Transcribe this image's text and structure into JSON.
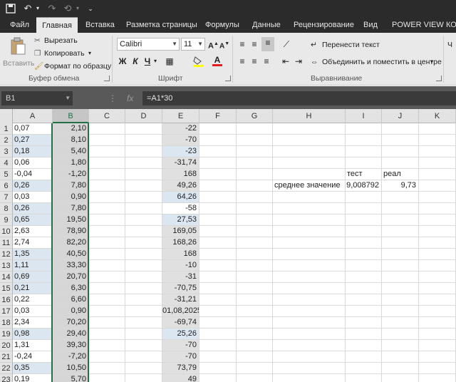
{
  "qat": {
    "save_icon": "save-icon",
    "undo_icon": "undo-icon",
    "redo_icon": "redo-icon",
    "custom_icon": "customize-icon"
  },
  "tabs": [
    {
      "label": "Файл",
      "active": false
    },
    {
      "label": "Главная",
      "active": true
    },
    {
      "label": "Вставка",
      "active": false
    },
    {
      "label": "Разметка страницы",
      "active": false
    },
    {
      "label": "Формулы",
      "active": false
    },
    {
      "label": "Данные",
      "active": false
    },
    {
      "label": "Рецензирование",
      "active": false
    },
    {
      "label": "Вид",
      "active": false
    },
    {
      "label": "POWER VIEW",
      "active": false
    },
    {
      "label": "КО",
      "active": false
    }
  ],
  "ribbon": {
    "paste_label": "Вставить",
    "cut_label": "Вырезать",
    "copy_label": "Копировать",
    "format_painter_label": "Формат по образцу",
    "clipboard_group": "Буфер обмена",
    "font_name": "Calibri",
    "font_size": "11",
    "bold": "Ж",
    "italic": "К",
    "underline": "Ч",
    "font_group": "Шрифт",
    "wrap_text_label": "Перенести текст",
    "merge_label": "Объединить и поместить в центре",
    "alignment_group": "Выравнивание",
    "right_cut_text": "Ч",
    "accent_color": "#217346"
  },
  "formula_bar": {
    "name_box": "B1",
    "formula": "=A1*30",
    "fx": "fx"
  },
  "columns": [
    "A",
    "B",
    "C",
    "D",
    "E",
    "F",
    "G",
    "H",
    "I",
    "J",
    "K"
  ],
  "selected_column": "B",
  "rows": [
    {
      "n": "1",
      "A": "0,07",
      "B": "2,10",
      "E": "-22"
    },
    {
      "n": "2",
      "A": "0,27",
      "B": "8,10",
      "E": "-70"
    },
    {
      "n": "3",
      "A": "0,18",
      "B": "5,40",
      "E": "-23"
    },
    {
      "n": "4",
      "A": "0,06",
      "B": "1,80",
      "E": "-31,74"
    },
    {
      "n": "5",
      "A": "-0,04",
      "B": "-1,20",
      "E": "168",
      "I": "тест",
      "J": "реал"
    },
    {
      "n": "6",
      "A": "0,26",
      "B": "7,80",
      "E": "49,26",
      "H": "среднее значение",
      "I": "9,008792",
      "J": "9,73"
    },
    {
      "n": "7",
      "A": "0,03",
      "B": "0,90",
      "E": "64,26"
    },
    {
      "n": "8",
      "A": "0,26",
      "B": "7,80",
      "E": "-58"
    },
    {
      "n": "9",
      "A": "0,65",
      "B": "19,50",
      "E": "27,53"
    },
    {
      "n": "10",
      "A": "2,63",
      "B": "78,90",
      "E": "169,05"
    },
    {
      "n": "11",
      "A": "2,74",
      "B": "82,20",
      "E": "168,26"
    },
    {
      "n": "12",
      "A": "1,35",
      "B": "40,50",
      "E": "168"
    },
    {
      "n": "13",
      "A": "1,11",
      "B": "33,30",
      "E": "-10"
    },
    {
      "n": "14",
      "A": "0,69",
      "B": "20,70",
      "E": "-31"
    },
    {
      "n": "15",
      "A": "0,21",
      "B": "6,30",
      "E": "-70,75"
    },
    {
      "n": "16",
      "A": "0,22",
      "B": "6,60",
      "E": "-31,21"
    },
    {
      "n": "17",
      "A": "0,03",
      "B": "0,90",
      "E": "01,08,2025"
    },
    {
      "n": "18",
      "A": "2,34",
      "B": "70,20",
      "E": "-69,74"
    },
    {
      "n": "19",
      "A": "0,98",
      "B": "29,40",
      "E": "25,26"
    },
    {
      "n": "20",
      "A": "1,31",
      "B": "39,30",
      "E": "-70"
    },
    {
      "n": "21",
      "A": "-0,24",
      "B": "-7,20",
      "E": "-70"
    },
    {
      "n": "22",
      "A": "0,35",
      "B": "10,50",
      "E": "73,79"
    },
    {
      "n": "23",
      "A": "0,19",
      "B": "5,70",
      "E": "49"
    }
  ]
}
